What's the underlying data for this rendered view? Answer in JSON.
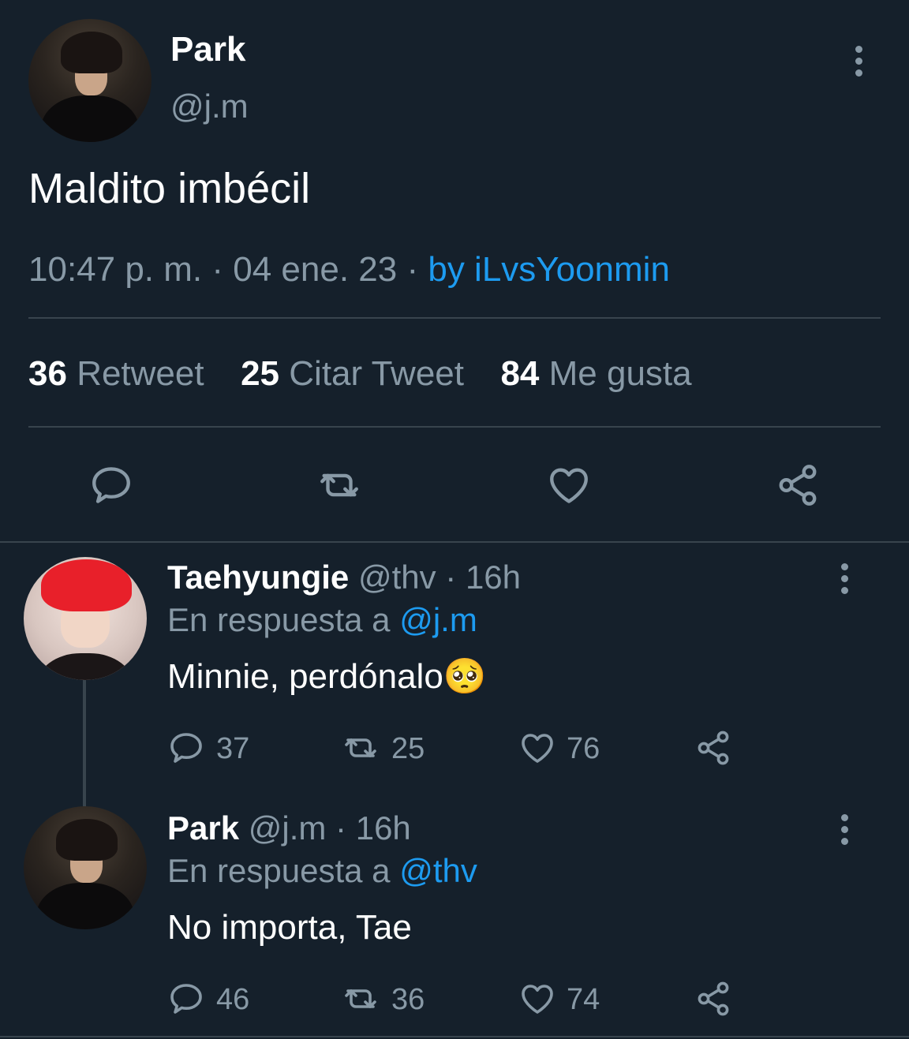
{
  "main_tweet": {
    "display_name": "Park",
    "handle": "@j.m",
    "text": "Maldito imbécil",
    "time": "10:47 p. m.",
    "dot1": "·",
    "date": "04 ene. 23",
    "dot2": "·",
    "source": "by iLvsYoonmin",
    "stats": {
      "retweets_count": "36",
      "retweets_label": "Retweet",
      "quotes_count": "25",
      "quotes_label": "Citar Tweet",
      "likes_count": "84",
      "likes_label": "Me gusta"
    }
  },
  "replies": [
    {
      "display_name": "Taehyungie",
      "handle": "@thv",
      "sep": "·",
      "time": "16h",
      "reply_prefix": "En respuesta a",
      "reply_to": "@j.m",
      "text": "Minnie, perdónalo",
      "emoji": "🥺",
      "reply_count": "37",
      "retweet_count": "25",
      "like_count": "76"
    },
    {
      "display_name": "Park",
      "handle": "@j.m",
      "sep": "·",
      "time": "16h",
      "reply_prefix": "En respuesta a",
      "reply_to": "@thv",
      "text": "No importa, Tae",
      "reply_count": "46",
      "retweet_count": "36",
      "like_count": "74"
    }
  ],
  "colors": {
    "background": "#15202b",
    "text": "#ffffff",
    "muted": "#8899a6",
    "link": "#1d9bf0",
    "divider": "#38444d"
  },
  "icons": [
    "reply-icon",
    "retweet-icon",
    "like-icon",
    "share-icon",
    "more-options-icon"
  ]
}
